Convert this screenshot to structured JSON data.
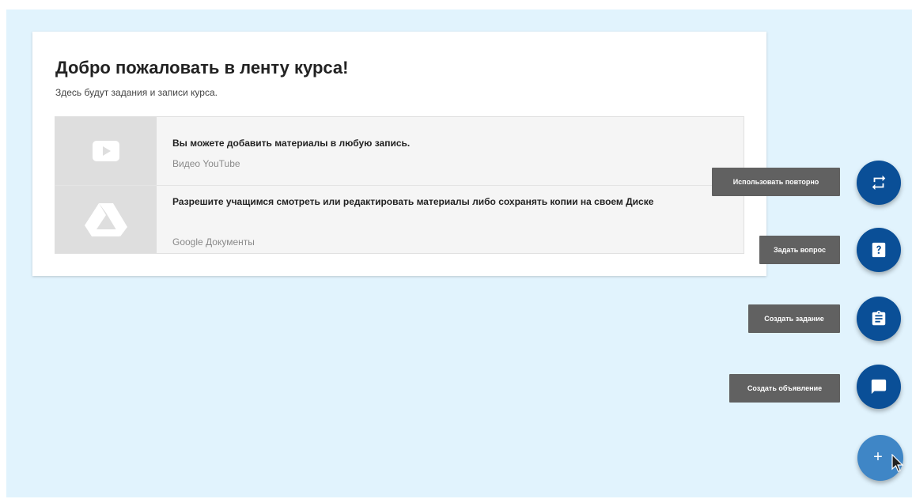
{
  "feed": {
    "title": "Добро пожаловать в ленту курса!",
    "subtitle": "Здесь будут задания и записи курса.",
    "materials": [
      {
        "icon": "youtube-play-icon",
        "title": "Вы можете добавить материалы в любую запись.",
        "source": "Видео YouTube"
      },
      {
        "icon": "google-drive-icon",
        "title": "Разрешите учащимся смотреть или редактировать материалы либо сохранять копии на своем Диске",
        "source": "Google Документы"
      }
    ]
  },
  "fab_menu": {
    "main_button": "+",
    "actions": [
      {
        "label": "Использовать повторно",
        "icon": "reuse-icon"
      },
      {
        "label": "Задать вопрос",
        "icon": "question-icon"
      },
      {
        "label": "Создать задание",
        "icon": "assignment-icon"
      },
      {
        "label": "Создать объявление",
        "icon": "announcement-icon"
      }
    ]
  },
  "colors": {
    "background": "#e1f3fd",
    "fab": "#0a4f97",
    "fab_main": "#3f86c6",
    "tooltip": "#616161"
  }
}
